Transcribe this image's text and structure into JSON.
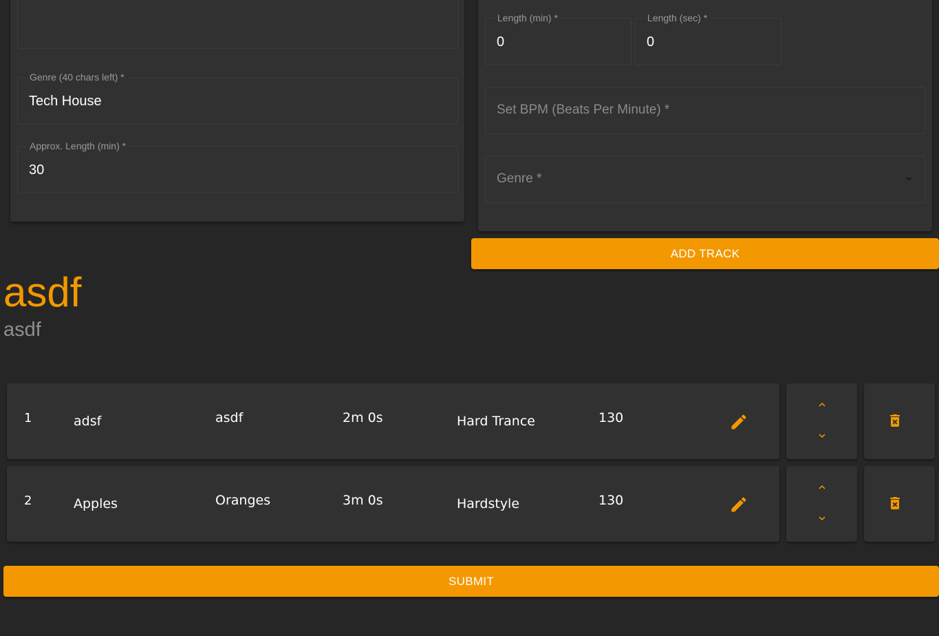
{
  "mix_form": {
    "genre_field": {
      "label": "Genre (40 chars left) *",
      "value": "Tech House"
    },
    "length_field": {
      "label": "Approx. Length (min) *",
      "value": "30"
    }
  },
  "track_form": {
    "length_min": {
      "label": "Length (min) *",
      "value": "0"
    },
    "length_sec": {
      "label": "Length (sec) *",
      "value": "0"
    },
    "bpm": {
      "placeholder": "Set BPM (Beats Per Minute) *"
    },
    "genre_select": {
      "placeholder": "Genre *"
    },
    "add_track_label": "ADD TRACK"
  },
  "mix": {
    "title": "asdf",
    "subtitle": "asdf"
  },
  "tracks": [
    {
      "number": "1",
      "title": "adsf",
      "artist": "asdf",
      "length": "2m 0s",
      "genre": "Hard Trance",
      "bpm": "130"
    },
    {
      "number": "2",
      "title": "Apples",
      "artist": "Oranges",
      "length": "3m 0s",
      "genre": "Hardstyle",
      "bpm": "130"
    }
  ],
  "submit_label": "SUBMIT",
  "colors": {
    "accent": "#f39800",
    "background": "#262626",
    "surface": "#313131"
  },
  "icons": {
    "edit": "pencil-icon",
    "move_up": "chevron-up-icon",
    "move_down": "chevron-down-icon",
    "delete": "trash-icon"
  }
}
